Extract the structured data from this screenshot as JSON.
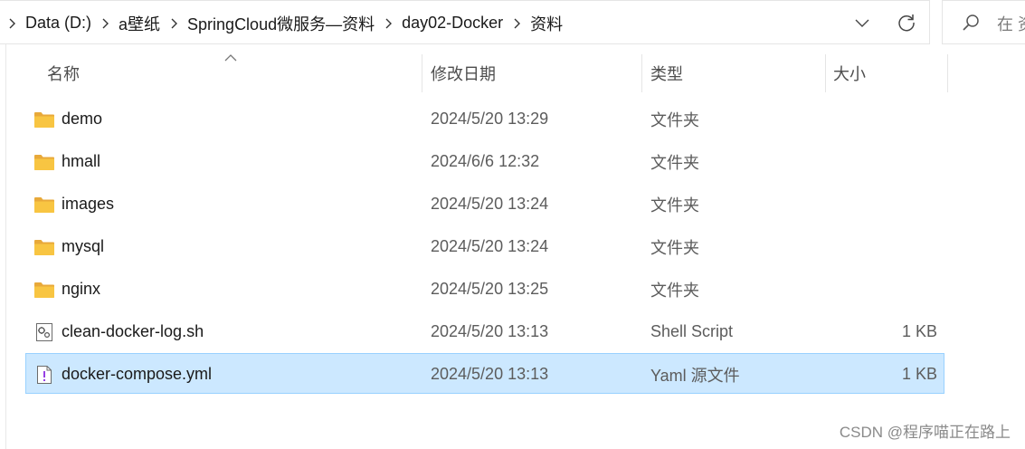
{
  "address_bar": {
    "breadcrumbs": [
      "Data (D:)",
      "a壁纸",
      "SpringCloud微服务—资料",
      "day02-Docker",
      "资料"
    ]
  },
  "search": {
    "placeholder": "在 资"
  },
  "columns": {
    "name": "名称",
    "date": "修改日期",
    "type": "类型",
    "size": "大小"
  },
  "files": [
    {
      "name": "demo",
      "date": "2024/5/20 13:29",
      "type": "文件夹",
      "size": "",
      "icon": "folder-icon"
    },
    {
      "name": "hmall",
      "date": "2024/6/6 12:32",
      "type": "文件夹",
      "size": "",
      "icon": "folder-icon"
    },
    {
      "name": "images",
      "date": "2024/5/20 13:24",
      "type": "文件夹",
      "size": "",
      "icon": "folder-icon"
    },
    {
      "name": "mysql",
      "date": "2024/5/20 13:24",
      "type": "文件夹",
      "size": "",
      "icon": "folder-icon"
    },
    {
      "name": "nginx",
      "date": "2024/5/20 13:25",
      "type": "文件夹",
      "size": "",
      "icon": "folder-icon"
    },
    {
      "name": "clean-docker-log.sh",
      "date": "2024/5/20 13:13",
      "type": "Shell Script",
      "size": "1 KB",
      "icon": "shell-script-icon"
    },
    {
      "name": "docker-compose.yml",
      "date": "2024/5/20 13:13",
      "type": "Yaml 源文件",
      "size": "1 KB",
      "icon": "yaml-file-icon",
      "selected": true
    }
  ],
  "watermark": "CSDN @程序喵正在路上",
  "colors": {
    "selection_bg": "#cce8ff",
    "selection_border": "#99d1ff",
    "folder": "#f8c542"
  }
}
